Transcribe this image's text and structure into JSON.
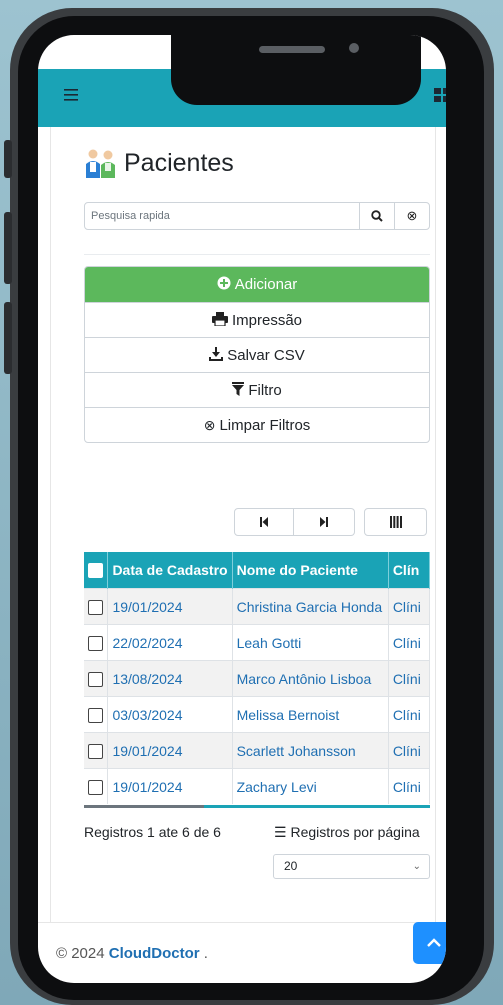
{
  "topbar": {
    "menu_icon": "hamburger-icon",
    "user_icon": "user-icon",
    "compress_icon": "compress-icon",
    "grid_icon": "grid-icon",
    "accent": "#1aa3b6"
  },
  "page": {
    "title": "Pacientes",
    "title_icon": "doctor-patient-icon"
  },
  "search": {
    "placeholder": "Pesquisa rapida",
    "search_glyph": "🔍",
    "clear_glyph": "⊗"
  },
  "actions": [
    {
      "label": "Adicionar",
      "icon": "plus-circle-icon",
      "glyph": "✚"
    },
    {
      "label": "Impressão",
      "icon": "print-icon",
      "glyph": "🖶"
    },
    {
      "label": "Salvar CSV",
      "icon": "download-icon",
      "glyph": "⭳"
    },
    {
      "label": "Filtro",
      "icon": "filter-icon",
      "glyph": "▼"
    },
    {
      "label": "Limpar Filtros",
      "icon": "clear-circle-icon",
      "glyph": "⊗"
    }
  ],
  "pager": {
    "first": "K",
    "last": "M",
    "columns": "IIII"
  },
  "table": {
    "headers": [
      "Data de Cadastro",
      "Nome do Paciente",
      "Clín"
    ],
    "rows": [
      {
        "date": "19/01/2024",
        "name": "Christina Garcia Honda",
        "clinic": "Clíni"
      },
      {
        "date": "22/02/2024",
        "name": "Leah Gotti",
        "clinic": "Clíni"
      },
      {
        "date": "13/08/2024",
        "name": "Marco Antônio Lisboa",
        "clinic": "Clíni"
      },
      {
        "date": "03/03/2024",
        "name": "Melissa Bernoist",
        "clinic": "Clíni"
      },
      {
        "date": "19/01/2024",
        "name": "Scarlett Johansson",
        "clinic": "Clíni"
      },
      {
        "date": "19/01/2024",
        "name": "Zachary Levi",
        "clinic": "Clíni"
      }
    ]
  },
  "pagination": {
    "records_text": "Registros 1 ate 6 de 6",
    "per_page_label": "Registros por página",
    "per_page_value": "20"
  },
  "footer": {
    "copyright": "© 2024",
    "brand": "CloudDoctor",
    "suffix": " ."
  }
}
